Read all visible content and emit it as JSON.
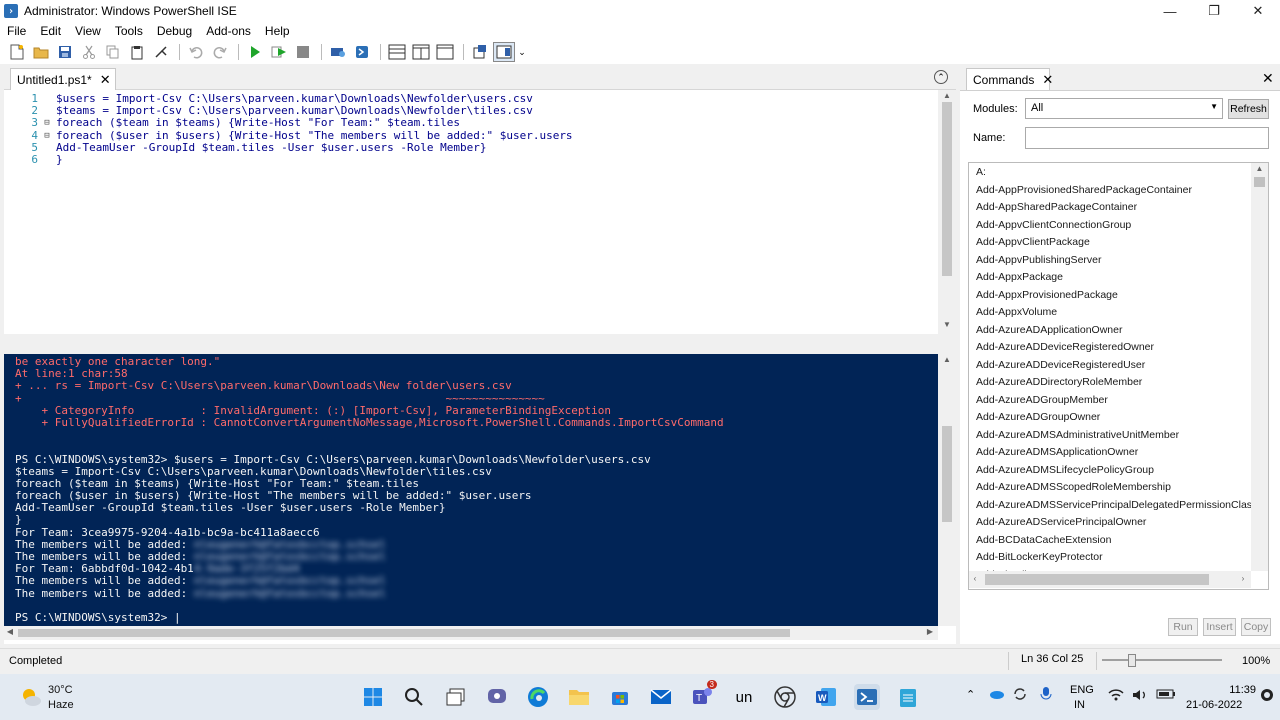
{
  "window": {
    "title": "Administrator: Windows PowerShell ISE",
    "app_icon_glyph": "›",
    "minimize_glyph": "—",
    "maximize_glyph": "❐",
    "close_glyph": "✕"
  },
  "menu": [
    "File",
    "Edit",
    "View",
    "Tools",
    "Debug",
    "Add-ons",
    "Help"
  ],
  "toolbar_icons": [
    "new-file-icon",
    "open-folder-icon",
    "save-icon",
    "cut-icon",
    "copy-icon",
    "paste-icon",
    "clear-icon",
    "undo-icon",
    "redo-icon",
    "run-icon",
    "run-selection-icon",
    "stop-icon",
    "new-remote-tab-icon",
    "start-powershell-icon",
    "layout-top-icon",
    "layout-right-icon",
    "layout-max-icon",
    "show-script-pane-icon",
    "show-commands-icon"
  ],
  "editor": {
    "tab_label": "Untitled1.ps1*",
    "tab_close": "✕",
    "collapse_glyph": "⌃",
    "lines": [
      {
        "n": "1",
        "fold": "",
        "text": "$users = Import-Csv C:\\Users\\parveen.kumar\\Downloads\\Newfolder\\users.csv"
      },
      {
        "n": "2",
        "fold": "",
        "text": "$teams = Import-Csv C:\\Users\\parveen.kumar\\Downloads\\Newfolder\\tiles.csv"
      },
      {
        "n": "3",
        "fold": "⊟",
        "text": "foreach ($team in $teams) {Write-Host \"For Team:\" $team.tiles"
      },
      {
        "n": "4",
        "fold": "⊟",
        "text": "foreach ($user in $users) {Write-Host \"The members will be added:\" $user.users"
      },
      {
        "n": "5",
        "fold": "",
        "text": "Add-TeamUser -GroupId $team.tiles -User $user.users -Role Member}"
      },
      {
        "n": "6",
        "fold": "",
        "text": "}"
      }
    ]
  },
  "console": {
    "lines": [
      {
        "cls": "err",
        "text": "be exactly one character long.\""
      },
      {
        "cls": "err",
        "text": "At line:1 char:58"
      },
      {
        "cls": "err",
        "text": "+ ... rs = Import-Csv C:\\Users\\parveen.kumar\\Downloads\\New folder\\users.csv"
      },
      {
        "cls": "err",
        "text": "+                                                                ~~~~~~~~~~~~~~~"
      },
      {
        "cls": "err",
        "text": "    + CategoryInfo          : InvalidArgument: (:) [Import-Csv], ParameterBindingException"
      },
      {
        "cls": "err",
        "text": "    + FullyQualifiedErrorId : CannotConvertArgumentNoMessage,Microsoft.PowerShell.Commands.ImportCsvCommand"
      },
      {
        "cls": "",
        "text": " "
      },
      {
        "cls": "",
        "text": " "
      },
      {
        "cls": "",
        "text": "PS C:\\WINDOWS\\system32> $users = Import-Csv C:\\Users\\parveen.kumar\\Downloads\\Newfolder\\users.csv"
      },
      {
        "cls": "",
        "text": "$teams = Import-Csv C:\\Users\\parveen.kumar\\Downloads\\Newfolder\\tiles.csv"
      },
      {
        "cls": "",
        "text": "foreach ($team in $teams) {Write-Host \"For Team:\" $team.tiles"
      },
      {
        "cls": "",
        "text": "foreach ($user in $users) {Write-Host \"The members will be added:\" $user.users"
      },
      {
        "cls": "",
        "text": "Add-TeamUser -GroupId $team.tiles -User $user.users -Role Member}"
      },
      {
        "cls": "",
        "text": "}"
      },
      {
        "cls": "",
        "text": "For Team: 3cea9975-9204-4a1b-bc9a-bc411a8aecc6"
      },
      {
        "cls": "",
        "text": "The members will be added: ",
        "blur": "nleugenerh@fatosbcctop.schsel"
      },
      {
        "cls": "",
        "text": "The members will be added: ",
        "blur": "nleugenerh@fatosbcctop.schsel"
      },
      {
        "cls": "",
        "text": "For Team: 6abbdf0d-1042-4b1",
        "blur": "4-9ade-3f25f2bd4"
      },
      {
        "cls": "",
        "text": "The members will be added: ",
        "blur": "nleugenerh@fatosbcctop.schsel"
      },
      {
        "cls": "",
        "text": "The members will be added: ",
        "blur": "nleugenerh@fatosbcctop.schsel"
      },
      {
        "cls": "",
        "text": " "
      },
      {
        "cls": "",
        "text": "PS C:\\WINDOWS\\system32> |"
      }
    ]
  },
  "commands": {
    "tab_label": "Commands",
    "tab_close": "✕",
    "pane_close": "✕",
    "modules_label": "Modules:",
    "modules_value": "All",
    "refresh_label": "Refresh",
    "name_label": "Name:",
    "name_value": "",
    "items": [
      "A:",
      "Add-AppProvisionedSharedPackageContainer",
      "Add-AppSharedPackageContainer",
      "Add-AppvClientConnectionGroup",
      "Add-AppvClientPackage",
      "Add-AppvPublishingServer",
      "Add-AppxPackage",
      "Add-AppxProvisionedPackage",
      "Add-AppxVolume",
      "Add-AzureADApplicationOwner",
      "Add-AzureADDeviceRegisteredOwner",
      "Add-AzureADDeviceRegisteredUser",
      "Add-AzureADDirectoryRoleMember",
      "Add-AzureADGroupMember",
      "Add-AzureADGroupOwner",
      "Add-AzureADMSAdministrativeUnitMember",
      "Add-AzureADMSApplicationOwner",
      "Add-AzureADMSLifecyclePolicyGroup",
      "Add-AzureADMSScopedRoleMembership",
      "Add-AzureADMSServicePrincipalDelegatedPermissionClassifi",
      "Add-AzureADServicePrincipalOwner",
      "Add-BCDataCacheExtension",
      "Add-BitLockerKeyProtector",
      "Add-BitsFile"
    ],
    "run_label": "Run",
    "insert_label": "Insert",
    "copy_label": "Copy"
  },
  "status": {
    "text": "Completed",
    "position": "Ln 36  Col 25",
    "zoom": "100%",
    "zoom_level": 0.25
  },
  "taskbar": {
    "weather_temp": "30°C",
    "weather_desc": "Haze",
    "apps": [
      "windows-start-icon",
      "search-icon",
      "task-view-icon",
      "teams-chat-icon",
      "edge-icon",
      "file-explorer-icon",
      "store-icon",
      "mail-icon",
      "teams-icon",
      "unknown-app-icon",
      "chrome-icon",
      "word-icon",
      "powershell-ise-icon",
      "notepad-icon"
    ],
    "teams_badge": "3",
    "un_label": "un",
    "lang1": "ENG",
    "lang2": "IN",
    "time": "11:39",
    "date": "21-06-2022"
  },
  "colors": {
    "console_bg": "#012456",
    "error_text": "#ff6b6b",
    "accent": "#0078d4"
  }
}
